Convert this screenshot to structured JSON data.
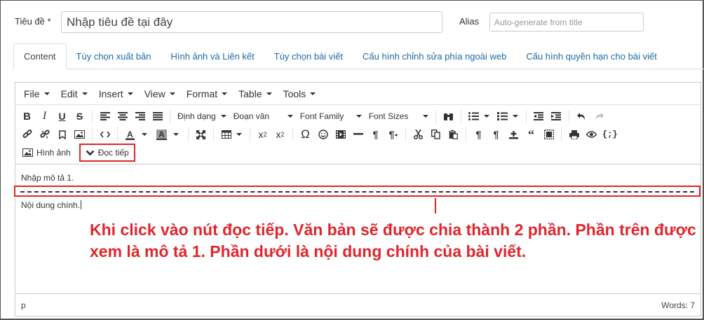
{
  "form": {
    "title_label": "Tiêu đề *",
    "title_value": "Nhập tiêu đề tại đây",
    "alias_label": "Alias",
    "alias_placeholder": "Auto-generate from title"
  },
  "tabs": [
    {
      "label": "Content",
      "active": true
    },
    {
      "label": "Tùy chọn xuất bản",
      "active": false
    },
    {
      "label": "Hình ảnh và Liên kết",
      "active": false
    },
    {
      "label": "Tùy chọn bài viết",
      "active": false
    },
    {
      "label": "Cấu hình chỉnh sửa phía ngoài web",
      "active": false
    },
    {
      "label": "Cấu hình quyền hạn cho bài viết",
      "active": false
    }
  ],
  "menubar": [
    "File",
    "Edit",
    "Insert",
    "View",
    "Format",
    "Table",
    "Tools"
  ],
  "toolbar": {
    "format_dropdown": "Định dạng",
    "paragraph_dropdown": "Đoạn văn",
    "font_family": "Font Family",
    "font_sizes": "Font Sizes",
    "image_button": "Hình ảnh",
    "readmore_button": "Đọc tiếp",
    "bold": "B",
    "italic": "I",
    "underline": "U",
    "strike": "S",
    "omega": "Ω",
    "subscript": "x",
    "superscript": "x"
  },
  "content": {
    "paragraph1": "Nhập mô tả 1.",
    "paragraph2": "Nội dung chính."
  },
  "annotation": "Khi click vào nút đọc tiếp. Văn bản sẽ được chia thành 2 phần. Phần trên được xem là mô tả 1. Phần dưới là nội dung chính của bài viết.",
  "status": {
    "path": "p",
    "words": "Words: 7"
  },
  "colors": {
    "accent_red": "#e0262c",
    "link_blue": "#1a6aa6"
  }
}
